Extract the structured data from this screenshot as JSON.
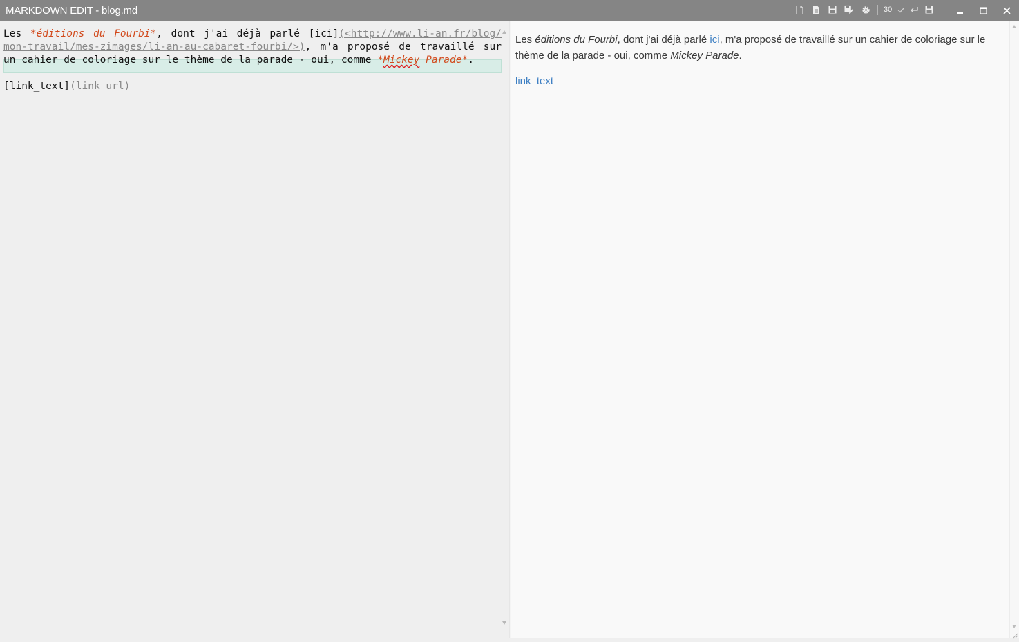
{
  "window": {
    "title": "MARKDOWN EDIT - blog.md"
  },
  "toolbar": {
    "icons": [
      "new-file-icon",
      "open-file-icon",
      "save-icon",
      "save-as-icon",
      "settings-icon",
      "spell-check-icon",
      "word-wrap-icon",
      "auto-save-icon"
    ],
    "font_size": "30"
  },
  "window_controls": [
    "minimize-icon",
    "maximize-icon",
    "close-icon"
  ],
  "editor": {
    "line1": {
      "t1": "Les ",
      "em1": "*éditions du Fourbi*",
      "t2": ", dont j'ai déjà parlé [ici]",
      "url1": "(<http://www.li-an.fr/blog/"
    },
    "line2": {
      "url2": "mon-travail/mes-zimages/li-an-au-cabaret-fourbi/>)",
      "t3": ", m'a proposé de travaillé sur"
    },
    "line3": {
      "t4": "un cahier de coloriage sur le thème de la parade - oui, comme ",
      "em_open": "*",
      "em_word1": "Mickey",
      "em_rest": " Parade*",
      "t5": "."
    },
    "line5": {
      "t6": "[link_text]",
      "url3": "(link url)"
    }
  },
  "preview": {
    "p1": {
      "t1": "Les ",
      "em1": "éditions du Fourbi",
      "t2": ", dont j'ai déjà parlé ",
      "link1": "ici",
      "t3": ", m'a proposé de travaillé sur un cahier de coloriage sur le thème de la parade - oui, comme ",
      "em2": "Mickey Parade",
      "t4": "."
    },
    "link2": "link_text"
  },
  "colors": {
    "titlebar": "#858585",
    "editor_bg": "#efefef",
    "preview_bg": "#f9f9f9",
    "emphasis": "#d24b1e",
    "link": "#3d7fc3",
    "current_line": "#d8ede7"
  }
}
